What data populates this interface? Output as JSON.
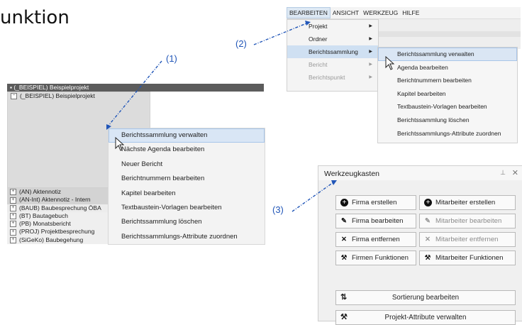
{
  "heading": "unktion",
  "tree": {
    "root_label": "(_BEISPIEL) Beispielprojekt",
    "project_label": "(_BEISPIEL) Beispielprojekt",
    "items": [
      {
        "label": "(AN) Aktennotiz",
        "toggle": "+"
      },
      {
        "label": "(AN-Int) Aktennotiz - Intern",
        "toggle": "+"
      },
      {
        "label": "(BAUB) Baubesprechung ÖBA",
        "toggle": "+"
      },
      {
        "label": "(BT) Bautagebuch",
        "toggle": "+"
      },
      {
        "label": "(PB) Monatsbericht",
        "toggle": "+"
      },
      {
        "label": "(PROJ) Projektbesprechung",
        "toggle": "+"
      },
      {
        "label": "(SiGeKo) Baubegehung",
        "toggle": "+"
      }
    ]
  },
  "context_menu": {
    "items": [
      "Berichtssammlung verwalten",
      "Nächste Agenda bearbeiten",
      "Neuer Bericht",
      "Berichtnummern bearbeiten",
      "Kapitel bearbeiten",
      "Textbaustein-Vorlagen bearbeiten",
      "Berichtssammlung löschen",
      "Berichtssammlungs-Attribute zuordnen"
    ]
  },
  "menubar": {
    "items": [
      "BEARBEITEN",
      "ANSICHT",
      "WERKZEUG",
      "HILFE"
    ],
    "dropdown": [
      {
        "label": "Projekt",
        "arrow": "▶"
      },
      {
        "label": "Ordner",
        "arrow": "▶"
      },
      {
        "label": "Berichtssammlung",
        "arrow": "▶"
      },
      {
        "label": "Bericht",
        "arrow": "▶"
      },
      {
        "label": "Berichtspunkt",
        "arrow": "▶"
      }
    ],
    "submenu": [
      "Berichtssammlung verwalten",
      "Agenda bearbeiten",
      "Berichtnummern bearbeiten",
      "Kapitel bearbeiten",
      "Textbaustein-Vorlagen bearbeiten",
      "Berichtssammlung löschen",
      "Berichtssammlungs-Attribute zuordnen"
    ]
  },
  "toolbox": {
    "title": "Werkzeugkasten",
    "pin": "⊥",
    "close": "✕",
    "firma_create": "Firma erstellen",
    "mitarbeiter_create": "Mitarbeiter erstellen",
    "firma_edit": "Firma bearbeiten",
    "mitarbeiter_edit": "Mitarbeiter bearbeiten",
    "firma_remove": "Firma entfernen",
    "mitarbeiter_remove": "Mitarbeiter entfernen",
    "firmen_funktionen": "Firmen Funktionen",
    "mitarbeiter_funktionen": "Mitarbeiter Funktionen",
    "sortierung": "Sortierung bearbeiten",
    "projekt_attribute": "Projekt-Attribute verwalten"
  },
  "annotations": {
    "one": "(1)",
    "two": "(2)",
    "three": "(3)"
  },
  "colors": {
    "annotation": "#2156b8",
    "highlight": "#d9e6f5"
  }
}
